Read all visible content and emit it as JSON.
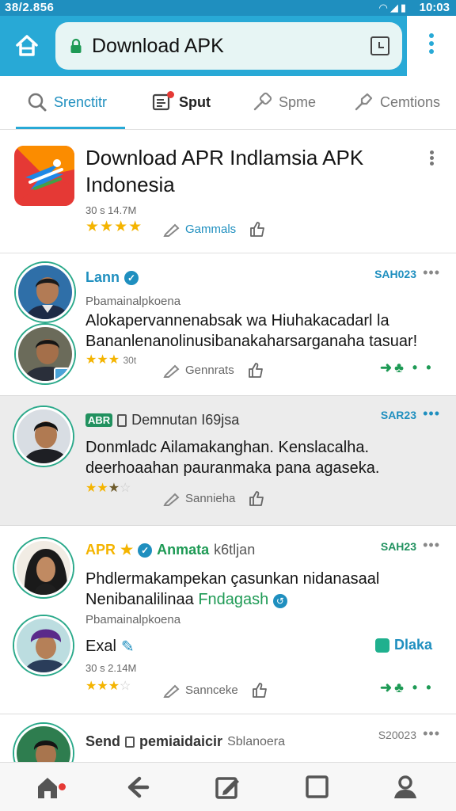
{
  "status_bar": {
    "carrier": "38/2.856",
    "time": "10:03"
  },
  "header": {
    "url_title": "Download APK",
    "accent": "#28a9d6"
  },
  "tabs": [
    {
      "label": "Srenctitr",
      "icon": "search-icon"
    },
    {
      "label": "Sput",
      "icon": "document-icon"
    },
    {
      "label": "Spme",
      "icon": "link-icon"
    },
    {
      "label": "Cemtions",
      "icon": "tag-icon"
    }
  ],
  "app": {
    "name": "Download APR Indlamsia APK Indonesia",
    "meta": "30 s 14.7M",
    "stars": "★★★★",
    "action_label": "Gammals"
  },
  "reviews": [
    {
      "name": "Lann",
      "date": "SAH023",
      "sub": "Pbamainalpkoena",
      "body": "Alokapervannenabsak wa Hiuhakacadarl la Bananlenanolinusibanakaharsarganaha tasuar!",
      "stars": "★★★",
      "stars_grey": "",
      "meta": "30t",
      "action_label": "Gennrats"
    },
    {
      "badge": "ABR",
      "name": "Demnutan I69jsa",
      "date": "SAR23",
      "body": "Donmladc Ailamakanghan. Kenslacalha. deerhoaahan pauranmaka pana agaseka.",
      "stars": "★★",
      "stars_half": "★",
      "stars_out": "☆",
      "action_label": "Sannieha"
    },
    {
      "badge_label": "APR",
      "name": "Anmata",
      "name_suffix": "k6tljan",
      "date": "SAH23",
      "body_line1": "Phdlermakampekan çasunkan nidanasaal",
      "body_line2": "Nenibanalilinaa",
      "body_link": "Fndagash",
      "sub": "Pbamainalpkoena",
      "second_name": "Exal",
      "second_action": "Dlaka",
      "meta": "30 s 2.14M",
      "stars": "★★★",
      "stars_out": "☆",
      "action_label": "Sannceke"
    },
    {
      "name": "Send",
      "name_mid": "pemiaidaicir",
      "name_suffix": "Sblanoera",
      "date": "S20023"
    }
  ],
  "colors": {
    "brand": "#28a9d6",
    "green": "#21915f",
    "star": "#f4b400",
    "notify": "#e53935"
  }
}
